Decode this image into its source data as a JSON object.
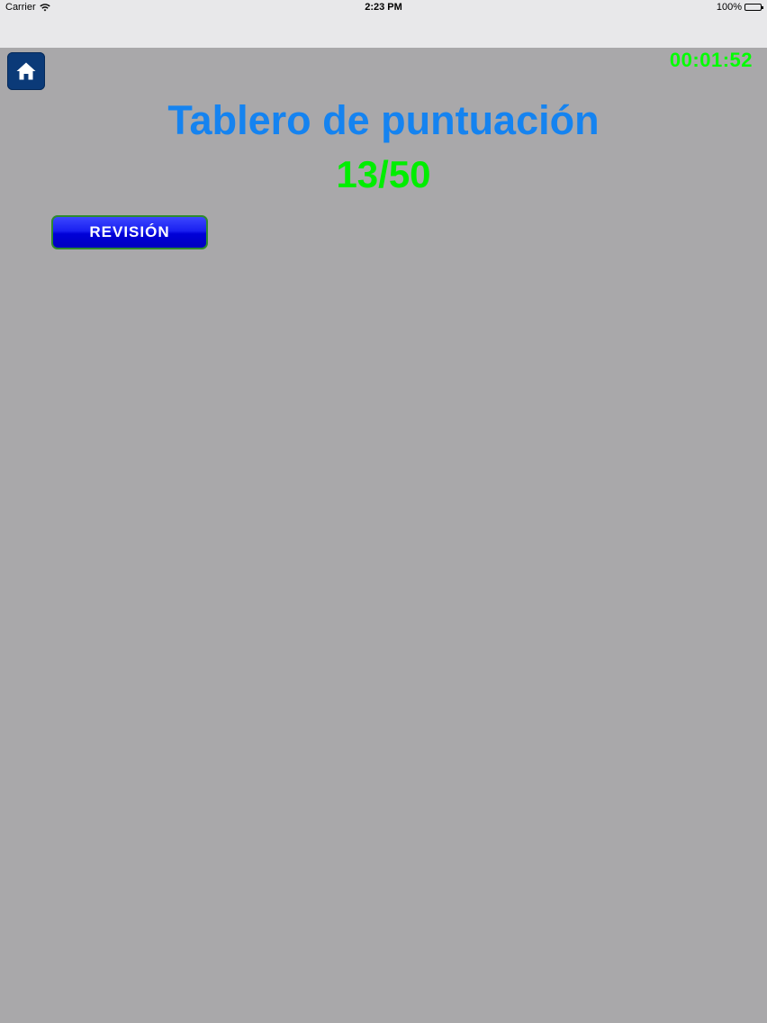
{
  "status_bar": {
    "carrier": "Carrier",
    "time": "2:23 PM",
    "battery": "100%"
  },
  "icons": {
    "home": "home-icon",
    "wifi": "wifi-icon",
    "battery": "battery-icon"
  },
  "timer": "00:01:52",
  "title": "Tablero de puntuación",
  "score": "13/50",
  "review_button_label": "REVISIÓN",
  "colors": {
    "background": "#a9a8aa",
    "title": "#1583f0",
    "score": "#00ee00",
    "timer": "#00ff00",
    "home_button": "#0b3a78",
    "review_button": "#0000d8",
    "review_border": "#2e8b2e"
  }
}
